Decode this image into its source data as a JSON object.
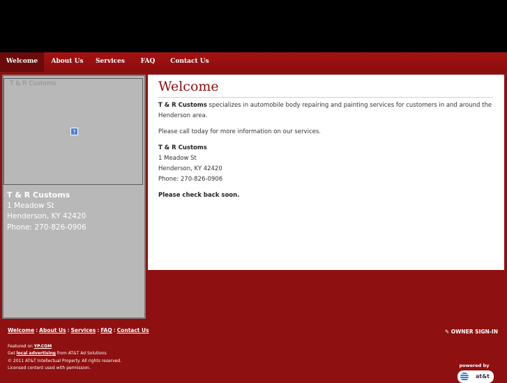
{
  "nav": {
    "tabs": [
      {
        "label": "Welcome",
        "active": true
      },
      {
        "label": "About Us"
      },
      {
        "label": "Services"
      },
      {
        "label": "FAQ"
      },
      {
        "label": "Contact Us"
      }
    ]
  },
  "sidebar": {
    "map_alt": "T & R Customs",
    "broken_image_glyph": "?",
    "name": "T & R Customs",
    "address1": "1 Meadow St",
    "address2": "Henderson, KY 42420",
    "phone": "Phone: 270-826-0906"
  },
  "main": {
    "heading": "Welcome",
    "intro_bold": "T & R Customs",
    "intro_rest": " specializes in automobile body repairing and painting services for customers in and around the Henderson area.",
    "call": "Please call today for more information on our services.",
    "contact_name": "T & R Customs",
    "contact_address1": "1 Meadow St",
    "contact_address2": "Henderson, KY 42420",
    "contact_phone": "Phone: 270-826-0906",
    "check_back": "Please check back soon."
  },
  "footer": {
    "links": [
      "Welcome",
      "About Us",
      "Services",
      "FAQ",
      "Contact Us"
    ],
    "separator": ":",
    "owner_signin": "OWNER SIGN-IN",
    "owner_signin_icon": "pencil-icon",
    "featured_prefix": "Featured on ",
    "featured_link": "YP.COM",
    "get_prefix": "Get ",
    "get_link": "local advertising",
    "get_suffix": " from AT&T Ad Solutions",
    "copyright": "© 2011 AT&T Intellectual Property. All rights reserved.",
    "licensed": "Licensed content used with permission.",
    "powered_by": "powered by",
    "att_text": "at&t"
  },
  "colors": {
    "background": "#8e1010",
    "header_band": "#000000",
    "heading": "#8b0d0d",
    "sidebar": "#b8b8b8"
  }
}
